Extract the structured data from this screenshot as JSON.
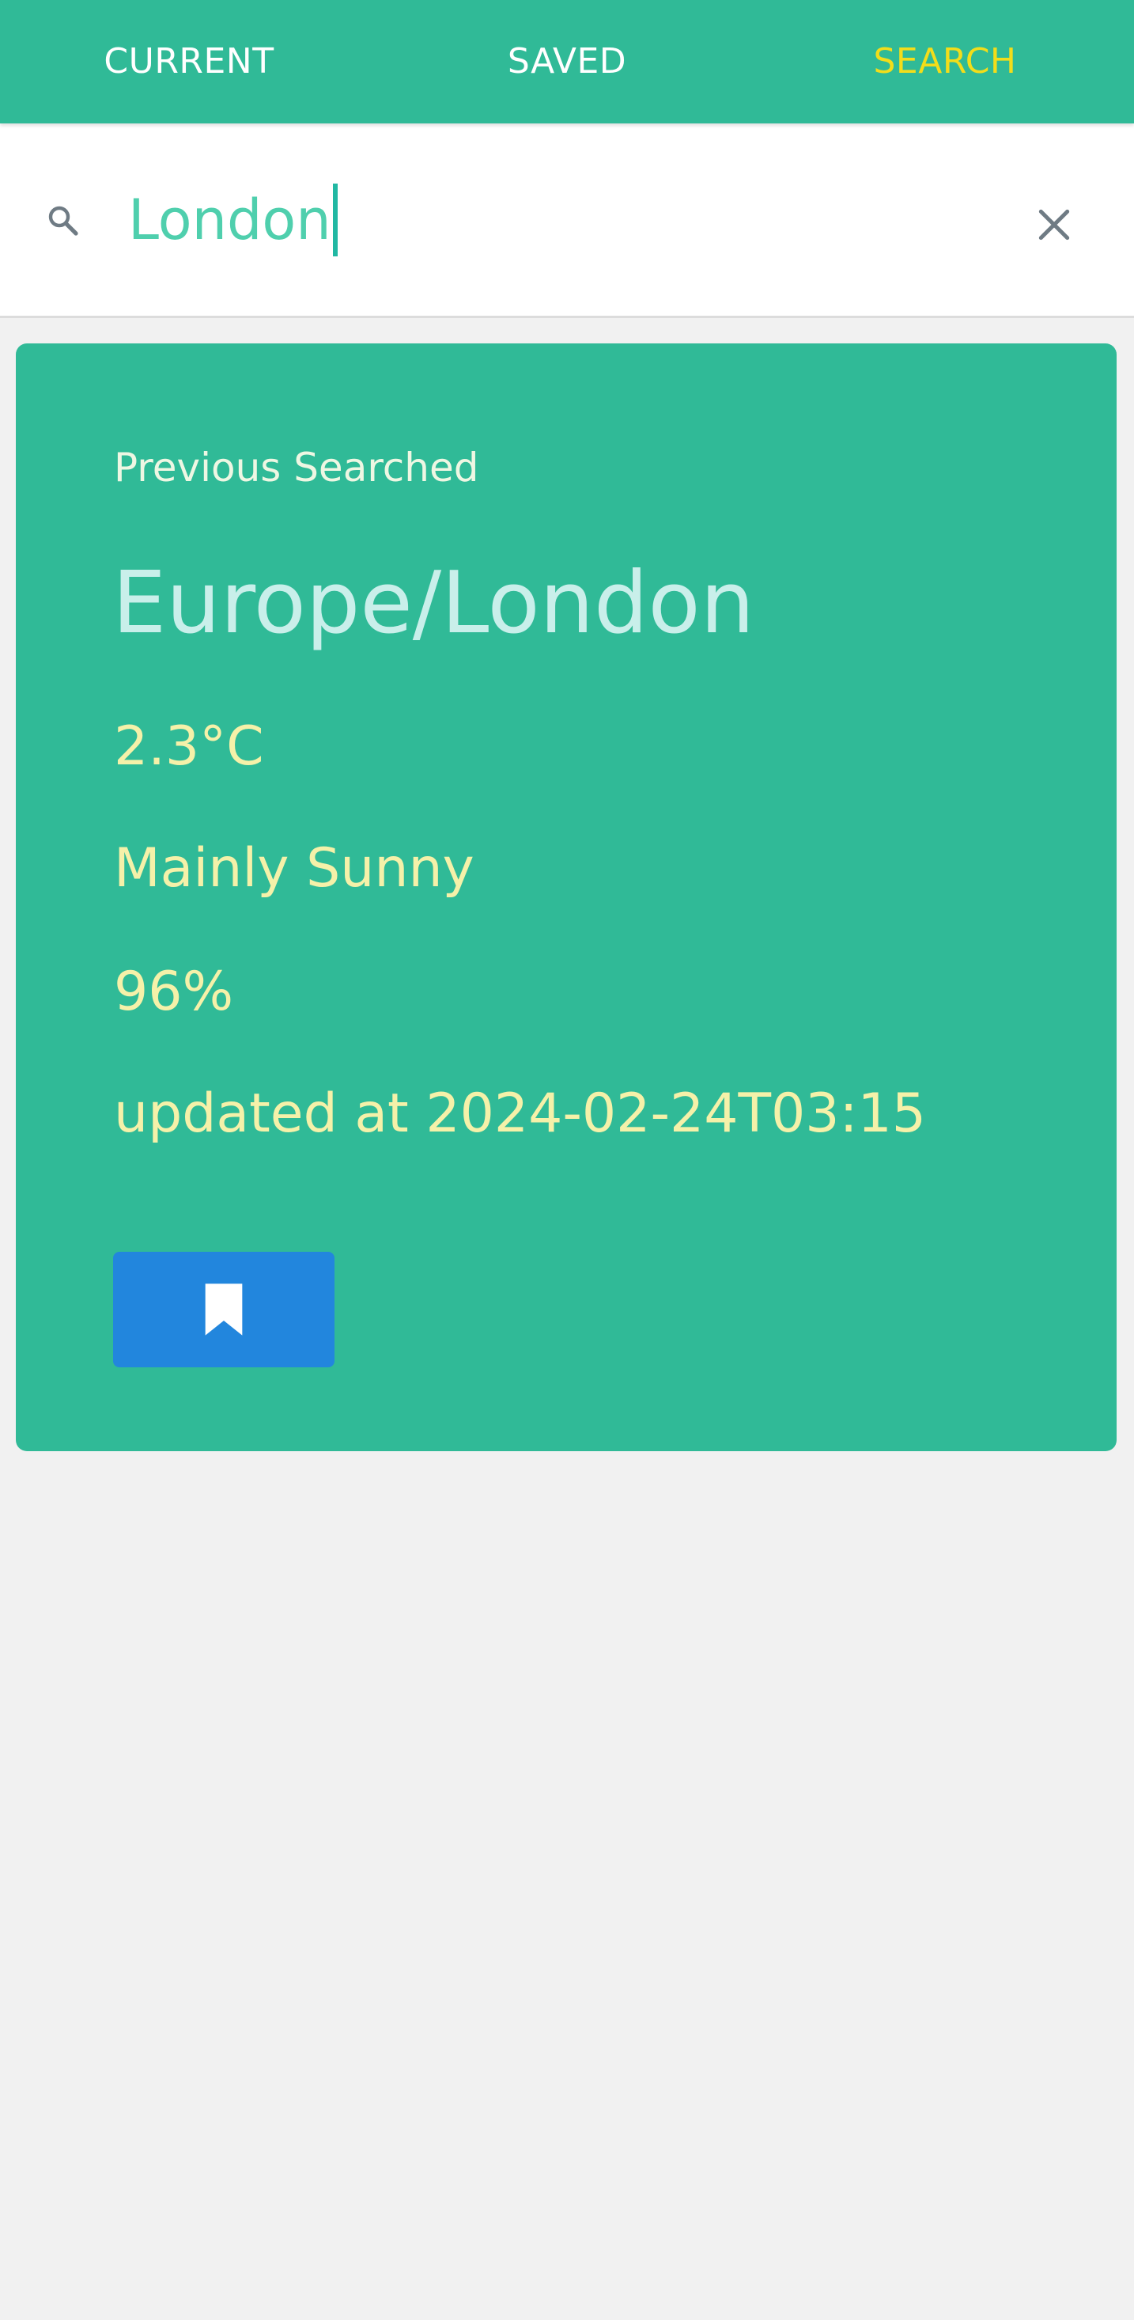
{
  "tabs": [
    {
      "label": "CURRENT",
      "active": false
    },
    {
      "label": "SAVED",
      "active": false
    },
    {
      "label": "SEARCH",
      "active": true
    }
  ],
  "search": {
    "value": "London",
    "search_icon": "search-icon",
    "clear_icon": "close-icon"
  },
  "result_card": {
    "label": "Previous Searched",
    "city": "Europe/London",
    "temperature": "2.3°C",
    "condition": "Mainly Sunny",
    "humidity": "96%",
    "updated": "updated at 2024-02-24T03:15",
    "bookmark_icon": "bookmark-icon"
  },
  "colors": {
    "primary": "#30ba97",
    "active_tab": "#f2dd1a",
    "input_text": "#4fcfad",
    "city_text": "#c9efea",
    "detail_text": "#f5f1a9",
    "bookmark_button": "#2286dd",
    "background": "#f1f1f1"
  }
}
